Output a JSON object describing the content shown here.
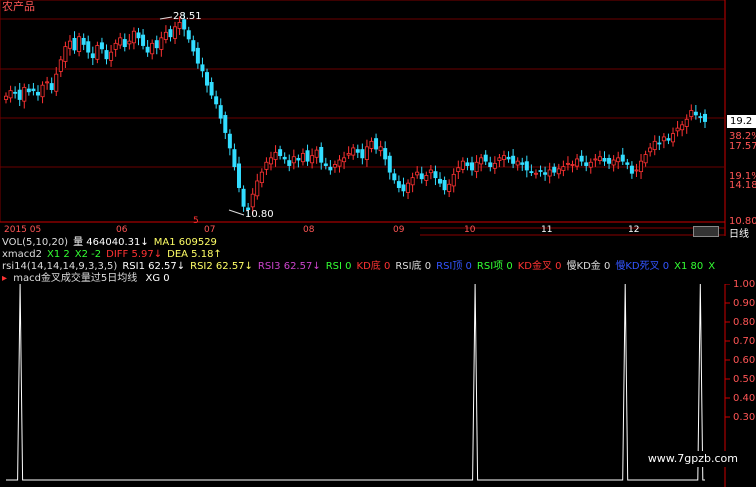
{
  "title": "农产品",
  "price_axis": {
    "current": "19.2",
    "labels": [
      "38.2%",
      "17.57",
      "19.1%",
      "14.18",
      "10.80"
    ]
  },
  "annotations": {
    "high": "28.51",
    "low": "10.80",
    "marker_label": "5"
  },
  "date_axis": {
    "labels": [
      "2015 05",
      "06",
      "07",
      "08",
      "09",
      "10",
      "11",
      "12"
    ]
  },
  "period_tab": "日线",
  "vol_row": [
    {
      "text": "VOL(5,10,20)",
      "color": "#dddddd"
    },
    {
      "text": "量 464040.31↓",
      "color": "#ffffff"
    },
    {
      "text": "MA1 609529",
      "color": "#ffff66"
    }
  ],
  "macd_row": [
    {
      "text": "xmacd2",
      "color": "#dddddd"
    },
    {
      "text": "X1 2",
      "color": "#33ff33"
    },
    {
      "text": "X2 -2",
      "color": "#33ff33"
    },
    {
      "text": "DIFF 5.97↓",
      "color": "#ff3333"
    },
    {
      "text": "DEA 5.18↑",
      "color": "#ffff66"
    }
  ],
  "rsi_row": [
    {
      "text": "rsi14(14,14,14,9,3,3,5)",
      "color": "#dddddd"
    },
    {
      "text": "RSI1 62.57↓",
      "color": "#ffffff"
    },
    {
      "text": "RSI2 62.57↓",
      "color": "#ffff66"
    },
    {
      "text": "RSI3 62.57↓",
      "color": "#cc44cc"
    },
    {
      "text": "RSI 0",
      "color": "#33ff33"
    },
    {
      "text": "KD底 0",
      "color": "#ff3333"
    },
    {
      "text": "RSI底 0",
      "color": "#dddddd"
    },
    {
      "text": "RSI顶 0",
      "color": "#3355ff"
    },
    {
      "text": "RSI项 0",
      "color": "#33ff33"
    },
    {
      "text": "KD金叉 0",
      "color": "#ff3333"
    },
    {
      "text": "慢KD金 0",
      "color": "#dddddd"
    },
    {
      "text": "慢KD死叉 0",
      "color": "#3355ff"
    },
    {
      "text": "X1 80",
      "color": "#33ff33"
    },
    {
      "text": "X",
      "color": "#33ff33"
    }
  ],
  "xg_row": {
    "marker": "▸",
    "name": "macd金叉成交量过5日均线",
    "xg": "XG 0"
  },
  "indicator_axis": {
    "labels": [
      "1.00",
      "0.90",
      "0.80",
      "0.70",
      "0.60",
      "0.50",
      "0.40",
      "0.30"
    ]
  },
  "watermark": "www.7gpzb.com",
  "chart_data": [
    {
      "type": "candlestick",
      "title": "农产品",
      "x_start": "2015 05",
      "ylim": [
        10.8,
        28.51
      ],
      "high": 28.51,
      "low": 10.8,
      "last": 19.2,
      "closes": [
        21.5,
        22.0,
        21.8,
        21.2,
        22.3,
        21.9,
        22.0,
        21.6,
        22.5,
        22.8,
        22.1,
        23.5,
        24.8,
        26.0,
        26.5,
        25.7,
        26.9,
        26.2,
        25.5,
        25.0,
        26.1,
        25.8,
        24.9,
        25.5,
        26.3,
        26.8,
        26.0,
        26.5,
        27.4,
        26.8,
        26.1,
        25.5,
        26.3,
        25.9,
        26.8,
        27.3,
        26.9,
        27.8,
        28.2,
        27.6,
        26.7,
        25.6,
        24.5,
        23.8,
        22.5,
        21.6,
        20.8,
        19.5,
        18.2,
        16.8,
        15.1,
        13.2,
        11.5,
        11.2,
        12.6,
        13.8,
        14.6,
        15.5,
        15.9,
        16.4,
        16.1,
        15.8,
        15.2,
        16.0,
        15.7,
        16.3,
        15.6,
        16.1,
        16.6,
        15.5,
        15.2,
        14.8,
        15.3,
        15.7,
        15.9,
        16.3,
        16.8,
        16.4,
        15.9,
        16.9,
        17.4,
        16.7,
        16.9,
        15.8,
        14.6,
        13.9,
        13.2,
        12.9,
        13.6,
        14.1,
        14.6,
        14.0,
        14.3,
        14.8,
        14.1,
        13.6,
        13.0,
        13.5,
        14.4,
        15.0,
        15.6,
        15.2,
        14.8,
        15.5,
        15.9,
        15.6,
        15.1,
        15.4,
        15.9,
        16.1,
        15.8,
        15.4,
        15.6,
        15.3,
        14.8,
        14.6,
        14.5,
        14.7,
        14.4,
        14.8,
        14.6,
        14.9,
        15.1,
        15.4,
        15.3,
        15.8,
        15.6,
        15.2,
        15.5,
        15.8,
        16.0,
        15.6,
        15.4,
        15.7,
        15.9,
        15.6,
        15.3,
        14.5,
        14.8,
        15.6,
        16.2,
        16.8,
        17.4,
        17.2,
        17.8,
        17.5,
        18.1,
        18.6,
        18.9,
        19.4,
        20.2,
        19.8,
        19.6,
        19.2
      ]
    },
    {
      "type": "line",
      "name": "XG",
      "ylim": [
        0,
        1.0
      ],
      "points": 150,
      "spikes_at": [
        3,
        100,
        132,
        148
      ],
      "values_desc": "0 except 1 at spike indices"
    }
  ]
}
